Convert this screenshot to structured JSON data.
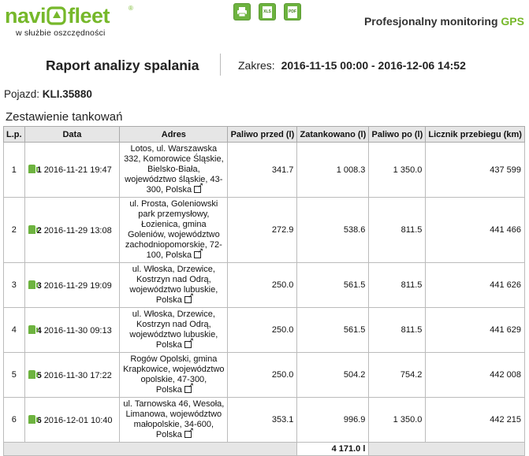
{
  "header": {
    "logo_left": "navi",
    "logo_right": "fleet",
    "logo_reg": "®",
    "tagline": "w służbie oszczędności",
    "slogan_main": "Profesjonalny monitoring ",
    "slogan_accent": "GPS",
    "export": [
      {
        "icon": "print-icon",
        "label": ""
      },
      {
        "icon": "xls-icon",
        "label": "XLS"
      },
      {
        "icon": "pdf-icon",
        "label": "PDF"
      }
    ]
  },
  "report": {
    "title": "Raport analizy spalania",
    "range_label": "Zakres:",
    "range_value": "2016-11-15 00:00 - 2016-12-06 14:52",
    "vehicle_label": "Pojazd:",
    "vehicle_value": "KLI.35880",
    "section_title": "Zestawienie tankowań"
  },
  "table": {
    "columns": [
      "L.p.",
      "Data",
      "Adres",
      "Paliwo przed (l)",
      "Zatankowano (l)",
      "Paliwo po (l)",
      "Licznik przebiegu (km)"
    ],
    "rows": [
      {
        "lp": "1",
        "idx": "1",
        "date": "2016-11-21 19:47",
        "addr": [
          "Lotos, ul. Warszawska",
          "332, Komorowice Śląskie,",
          "Bielsko-Biała,",
          "województwo śląskie, 43-",
          "300, Polska"
        ],
        "before": "341.7",
        "refuel": "1 008.3",
        "after": "1 350.0",
        "odo": "437 599"
      },
      {
        "lp": "2",
        "idx": "2",
        "date": "2016-11-29 13:08",
        "addr": [
          "ul. Prosta, Goleniowski",
          "park przemysłowy,",
          "Łozienica, gmina",
          "Goleniów, województwo",
          "zachodniopomorskie, 72-",
          "100, Polska"
        ],
        "before": "272.9",
        "refuel": "538.6",
        "after": "811.5",
        "odo": "441 466"
      },
      {
        "lp": "3",
        "idx": "3",
        "date": "2016-11-29 19:09",
        "addr": [
          "ul. Włoska, Drzewice,",
          "Kostrzyn nad Odrą,",
          "województwo lubuskie,",
          "Polska"
        ],
        "before": "250.0",
        "refuel": "561.5",
        "after": "811.5",
        "odo": "441 626"
      },
      {
        "lp": "4",
        "idx": "4",
        "date": "2016-11-30 09:13",
        "addr": [
          "ul. Włoska, Drzewice,",
          "Kostrzyn nad Odrą,",
          "województwo lubuskie,",
          "Polska"
        ],
        "before": "250.0",
        "refuel": "561.5",
        "after": "811.5",
        "odo": "441 629"
      },
      {
        "lp": "5",
        "idx": "5",
        "date": "2016-11-30 17:22",
        "addr": [
          "Rogów Opolski, gmina",
          "Krapkowice, województwo",
          "opolskie, 47-300,",
          "Polska"
        ],
        "before": "250.0",
        "refuel": "504.2",
        "after": "754.2",
        "odo": "442 008"
      },
      {
        "lp": "6",
        "idx": "6",
        "date": "2016-12-01 10:40",
        "addr": [
          "ul. Tarnowska 46, Wesoła,",
          "Limanowa, województwo",
          "małopolskie, 34-600,",
          "Polska"
        ],
        "before": "353.1",
        "refuel": "996.9",
        "after": "1 350.0",
        "odo": "442 215"
      }
    ],
    "total_refuel": "4 171.0 l"
  }
}
